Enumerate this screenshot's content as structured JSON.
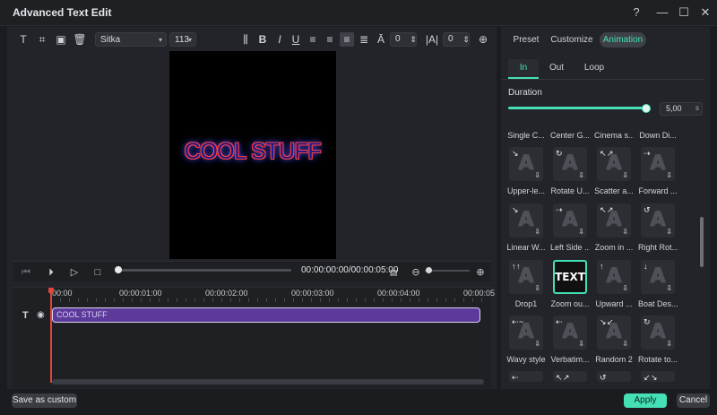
{
  "window": {
    "title": "Advanced Text Edit"
  },
  "icons": {
    "help": "?",
    "minimize": "—",
    "maximize": "☐",
    "close": "✕"
  },
  "toolbar": {
    "font": "Sitka",
    "size": "113",
    "spacing_value": "0",
    "kerning_value": "0"
  },
  "preview": {
    "text": "COOL STUFF"
  },
  "playback": {
    "timecode": "00:00:00:00/00:00:05:00"
  },
  "timeline": {
    "ticks": [
      "00:00",
      "00:00:01:00",
      "00:00:02:00",
      "00:00:03:00",
      "00:00:04:00",
      "00:00:05"
    ],
    "clip_label": "COOL STUFF"
  },
  "right_panel": {
    "tabs": [
      "Preset",
      "Customize",
      "Animation"
    ],
    "subtabs": [
      "In",
      "Out",
      "Loop"
    ],
    "duration_label": "Duration",
    "duration_value": "5,00",
    "duration_unit": "s",
    "duration_fraction": 1.0,
    "top_row_names": [
      "Single C...",
      "Center G...",
      "Cinema s...",
      "Down Di..."
    ],
    "animations": [
      [
        "Upper-le...",
        "Rotate U...",
        "Scatter a...",
        "Forward ..."
      ],
      [
        "Linear W...",
        "Left Side ...",
        "Zoom in ...",
        "Right Rot..."
      ],
      [
        "Drop1",
        "Zoom ou...",
        "Upward ...",
        "Boat Des..."
      ],
      [
        "Wavy style",
        "Verbatim...",
        "Random 2",
        "Rotate to..."
      ]
    ],
    "selected_thumb_text": "TEXT"
  },
  "footer": {
    "save_custom": "Save as custom",
    "apply": "Apply",
    "cancel": "Cancel"
  },
  "colors": {
    "accent": "#45e0b5",
    "clip": "#5c3a9b",
    "playhead": "#e2453a"
  }
}
